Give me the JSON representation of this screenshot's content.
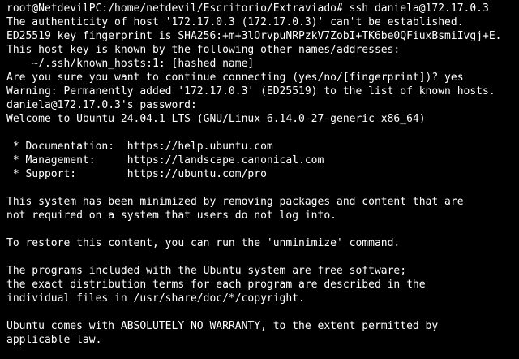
{
  "terminal": {
    "lines": [
      "root@NetdevilPC:/home/netdevil/Escritorio/Extraviado# ssh daniela@172.17.0.3",
      "The authenticity of host '172.17.0.3 (172.17.0.3)' can't be established.",
      "ED25519 key fingerprint is SHA256:+m+3lOrvpuNRPzkV7ZobI+TK6be0QFiuxBsmiIvgj+E.",
      "This host key is known by the following other names/addresses:",
      "    ~/.ssh/known_hosts:1: [hashed name]",
      "Are you sure you want to continue connecting (yes/no/[fingerprint])? yes",
      "Warning: Permanently added '172.17.0.3' (ED25519) to the list of known hosts.",
      "daniela@172.17.0.3's password:",
      "Welcome to Ubuntu 24.04.1 LTS (GNU/Linux 6.14.0-27-generic x86_64)",
      "",
      " * Documentation:  https://help.ubuntu.com",
      " * Management:     https://landscape.canonical.com",
      " * Support:        https://ubuntu.com/pro",
      "",
      "This system has been minimized by removing packages and content that are",
      "not required on a system that users do not log into.",
      "",
      "To restore this content, you can run the 'unminimize' command.",
      "",
      "The programs included with the Ubuntu system are free software;",
      "the exact distribution terms for each program are described in the",
      "individual files in /usr/share/doc/*/copyright.",
      "",
      "Ubuntu comes with ABSOLUTELY NO WARRANTY, to the extent permitted by",
      "applicable law."
    ]
  }
}
